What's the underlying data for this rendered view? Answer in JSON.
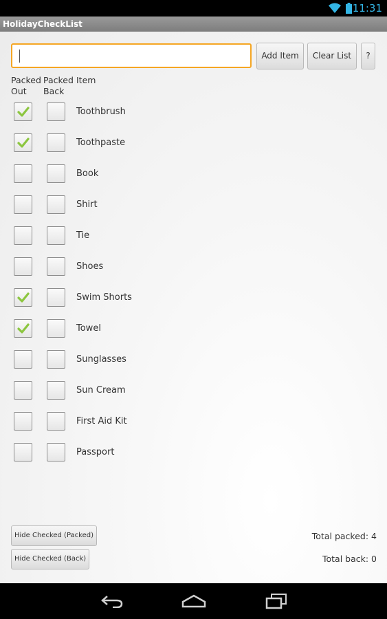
{
  "status_bar": {
    "time": "11:31",
    "wifi_icon": "wifi-icon",
    "battery_icon": "battery-icon",
    "time_color": "#33b5e5"
  },
  "app": {
    "title": "HolidayCheckList"
  },
  "toolbar": {
    "input_value": "",
    "add_label": "Add Item",
    "clear_label": "Clear List",
    "help_label": "?"
  },
  "headers": {
    "packed_out_line1": "Packed",
    "packed_out_line2": "Out",
    "packed_back_line1": "Packed",
    "packed_back_line2": "Back",
    "item": "Item"
  },
  "items": [
    {
      "name": "Toothbrush",
      "out": true,
      "back": false
    },
    {
      "name": "Toothpaste",
      "out": true,
      "back": false
    },
    {
      "name": "Book",
      "out": false,
      "back": false
    },
    {
      "name": "Shirt",
      "out": false,
      "back": false
    },
    {
      "name": "Tie",
      "out": false,
      "back": false
    },
    {
      "name": "Shoes",
      "out": false,
      "back": false
    },
    {
      "name": "Swim Shorts",
      "out": true,
      "back": false
    },
    {
      "name": "Towel",
      "out": true,
      "back": false
    },
    {
      "name": "Sunglasses",
      "out": false,
      "back": false
    },
    {
      "name": "Sun Cream",
      "out": false,
      "back": false
    },
    {
      "name": "First Aid Kit",
      "out": false,
      "back": false
    },
    {
      "name": "Passport",
      "out": false,
      "back": false
    }
  ],
  "footer": {
    "hide_packed_label": "Hide Checked (Packed)",
    "hide_back_label": "Hide Checked (Back)",
    "total_packed": "Total packed: 4",
    "total_back": "Total back: 0"
  },
  "colors": {
    "accent": "#f5a623",
    "check": "#8cc63f"
  },
  "nav": [
    "back-icon",
    "home-icon",
    "recent-apps-icon"
  ]
}
